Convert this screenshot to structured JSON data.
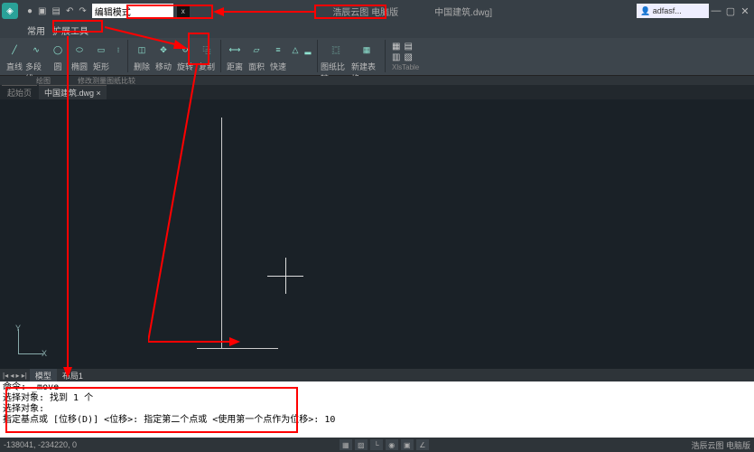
{
  "title_bar": {
    "edit_mode": "编辑模式",
    "brand": "浩辰云图 电脑版",
    "filename": "中国建筑.dwg]",
    "search_ph": "adfasf..."
  },
  "tabs": {
    "common": "常用",
    "extend": "扩展工具"
  },
  "ribbon": {
    "line": "直线",
    "pline": "多段线",
    "circle": "圆",
    "ellipse": "椭圆",
    "rect": "矩形",
    "erase": "删除",
    "move": "移动",
    "rotate": "旋转",
    "copy": "复制",
    "dist": "距离",
    "area": "面积",
    "quick": "快速",
    "dwg": "图纸比较",
    "table": "新建表格",
    "xls": "XlsTable",
    "grp_draw": "绘图",
    "grp_modify": "修改",
    "grp_measure": "测量",
    "grp_dwg": "图纸比较"
  },
  "doctab": {
    "start": "起始页",
    "file": "中国建筑.dwg"
  },
  "axis": {
    "x": "X",
    "y": "Y"
  },
  "model": {
    "model": "模型",
    "layout1": "布局1"
  },
  "cmd": {
    "l1": "命令: _move",
    "l2": "选择对象: 找到 1 个",
    "l3": "选择对象:",
    "l4": "指定基点或 [位移(D)] <位移>:  指定第二个点或 <使用第一个点作为位移>: 10"
  },
  "status": {
    "coords": "-138041, -234220, 0",
    "brand": "浩辰云图 电脑版"
  }
}
